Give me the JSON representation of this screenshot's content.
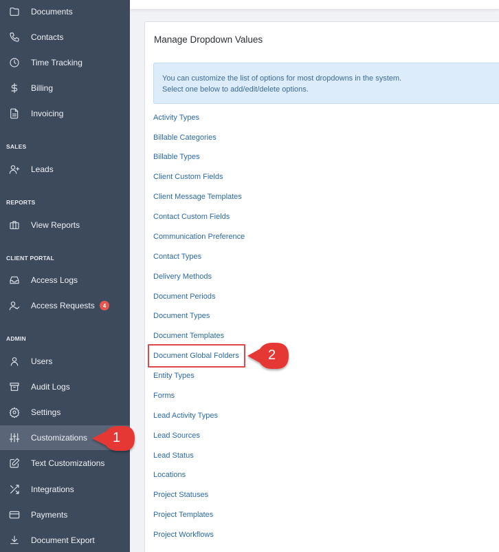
{
  "sidebar": {
    "items": [
      {
        "label": "Documents",
        "icon": "folder-icon",
        "active": false
      },
      {
        "label": "Contacts",
        "icon": "phone-icon",
        "active": false
      },
      {
        "label": "Time Tracking",
        "icon": "clock-icon",
        "active": false
      },
      {
        "label": "Billing",
        "icon": "dollar-icon",
        "active": false
      },
      {
        "label": "Invoicing",
        "icon": "document-icon",
        "active": false
      },
      {
        "label": "Leads",
        "icon": "user-plus-icon",
        "active": false
      },
      {
        "label": "View Reports",
        "icon": "briefcase-icon",
        "active": false
      },
      {
        "label": "Access Logs",
        "icon": "inbox-icon",
        "active": false
      },
      {
        "label": "Access Requests",
        "icon": "user-check-icon",
        "active": false,
        "badge": "4"
      },
      {
        "label": "Users",
        "icon": "user-icon",
        "active": false
      },
      {
        "label": "Audit Logs",
        "icon": "archive-icon",
        "active": false
      },
      {
        "label": "Settings",
        "icon": "gear-icon",
        "active": false
      },
      {
        "label": "Customizations",
        "icon": "sliders-icon",
        "active": true
      },
      {
        "label": "Text Customizations",
        "icon": "edit-icon",
        "active": false
      },
      {
        "label": "Integrations",
        "icon": "shuffle-icon",
        "active": false
      },
      {
        "label": "Payments",
        "icon": "credit-card-icon",
        "active": false
      },
      {
        "label": "Document Export",
        "icon": "download-icon",
        "active": false
      }
    ],
    "sections": {
      "sales": "SALES",
      "reports": "REPORTS",
      "client_portal": "CLIENT PORTAL",
      "admin": "ADMIN"
    }
  },
  "main": {
    "title": "Manage Dropdown Values",
    "info_line1": "You can customize the list of options for most dropdowns in the system.",
    "info_line2": "Select one below to add/edit/delete options.",
    "links": [
      "Activity Types",
      "Billable Categories",
      "Billable Types",
      "Client Custom Fields",
      "Client Message Templates",
      "Contact Custom Fields",
      "Communication Preference",
      "Contact Types",
      "Delivery Methods",
      "Document Periods",
      "Document Types",
      "Document Templates",
      "Document Global Folders",
      "Entity Types",
      "Forms",
      "Lead Activity Types",
      "Lead Sources",
      "Lead Status",
      "Locations",
      "Project Statuses",
      "Project Templates",
      "Project Workflows"
    ]
  },
  "annotations": {
    "callout1": "1",
    "callout2": "2",
    "color": "#e53935"
  }
}
